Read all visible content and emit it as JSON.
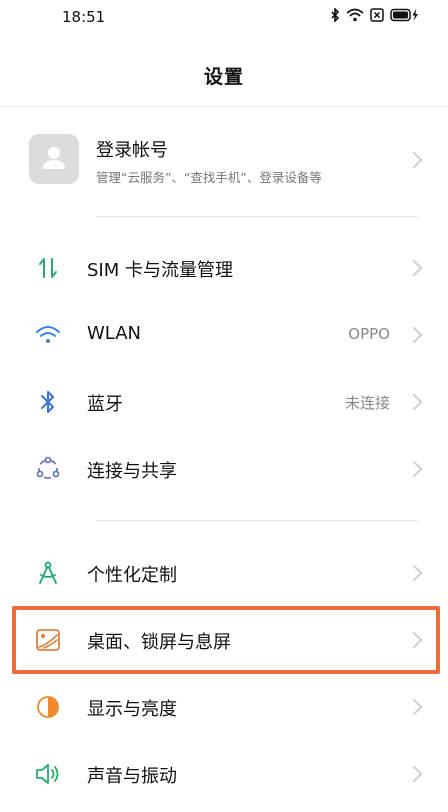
{
  "status_bar": {
    "time": "18:51",
    "icons": [
      "bluetooth-icon",
      "wifi-icon",
      "sim-x-icon",
      "battery-charging-icon"
    ]
  },
  "header": {
    "title": "设置"
  },
  "account": {
    "title": "登录帐号",
    "subtitle": "管理“云服务”、“查找手机”、登录设备等"
  },
  "sections": [
    {
      "items": [
        {
          "label": "SIM 卡与流量管理",
          "value": "",
          "icon": "sim-data-icon"
        },
        {
          "label": "WLAN",
          "value": "OPPO",
          "icon": "wifi-icon"
        },
        {
          "label": "蓝牙",
          "value": "未连接",
          "icon": "bluetooth-icon"
        },
        {
          "label": "连接与共享",
          "value": "",
          "icon": "connection-share-icon"
        }
      ]
    },
    {
      "items": [
        {
          "label": "个性化定制",
          "value": "",
          "icon": "personalize-icon"
        },
        {
          "label": "桌面、锁屏与息屏",
          "value": "",
          "icon": "wallpaper-icon"
        },
        {
          "label": "显示与亮度",
          "value": "",
          "icon": "brightness-icon"
        },
        {
          "label": "声音与振动",
          "value": "",
          "icon": "sound-icon"
        }
      ]
    }
  ],
  "colors": {
    "highlight": "#ec6d3a",
    "sim_icon": "#2aa86b",
    "wifi_icon": "#3b7fe0",
    "bluetooth_icon": "#3b6fd8",
    "connection_icon": "#5a6fb5",
    "personalize_icon": "#20a86a",
    "wallpaper_icon": "#e0803a",
    "brightness_icon": "#f08a2a",
    "sound_icon": "#2aa86b"
  }
}
